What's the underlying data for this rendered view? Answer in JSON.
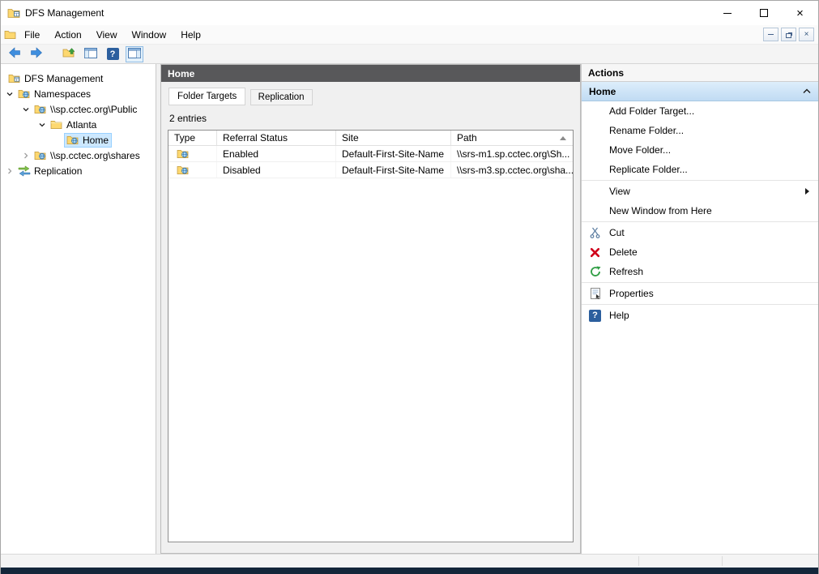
{
  "window": {
    "title": "DFS Management"
  },
  "icons": {
    "close_glyph": "×",
    "help_glyph": "?"
  },
  "menubar": {
    "items": [
      "File",
      "Action",
      "View",
      "Window",
      "Help"
    ]
  },
  "tree": {
    "items": [
      {
        "label": "DFS Management",
        "level": 0,
        "expander": "none",
        "icon": "console-root-icon",
        "selected": false
      },
      {
        "label": "Namespaces",
        "level": 1,
        "expander": "expanded",
        "icon": "namespaces-icon",
        "selected": false
      },
      {
        "label": "\\\\sp.cctec.org\\Public",
        "level": 2,
        "expander": "expanded",
        "icon": "namespace-icon",
        "selected": false
      },
      {
        "label": "Atlanta",
        "level": 3,
        "expander": "expanded",
        "icon": "folder-icon",
        "selected": false
      },
      {
        "label": "Home",
        "level": 4,
        "expander": "none",
        "icon": "folder-target-icon",
        "selected": true
      },
      {
        "label": "\\\\sp.cctec.org\\shares",
        "level": 2,
        "expander": "collapsed",
        "icon": "namespace-icon",
        "selected": false
      },
      {
        "label": "Replication",
        "level": 1,
        "expander": "collapsed",
        "icon": "replication-icon",
        "selected": false
      }
    ]
  },
  "main": {
    "header": "Home",
    "tabs": [
      {
        "label": "Folder Targets",
        "active": true
      },
      {
        "label": "Replication",
        "active": false
      }
    ],
    "entries_label": "2 entries",
    "table": {
      "columns": [
        {
          "label": "Type"
        },
        {
          "label": "Referral Status"
        },
        {
          "label": "Site"
        },
        {
          "label": "Path",
          "sorted": "asc"
        }
      ],
      "rows": [
        {
          "referral_status": "Enabled",
          "site": "Default-First-Site-Name",
          "path": "\\\\srs-m1.sp.cctec.org\\Sh..."
        },
        {
          "referral_status": "Disabled",
          "site": "Default-First-Site-Name",
          "path": "\\\\srs-m3.sp.cctec.org\\sha..."
        }
      ]
    }
  },
  "actions": {
    "title": "Actions",
    "section": {
      "label": "Home"
    },
    "items": [
      {
        "label": "Add Folder Target..."
      },
      {
        "label": "Rename Folder..."
      },
      {
        "label": "Move Folder..."
      },
      {
        "label": "Replicate Folder..."
      },
      {
        "label": "View",
        "submenu": true
      },
      {
        "label": "New Window from Here"
      },
      {
        "label": "Cut",
        "icon": "cut-icon"
      },
      {
        "label": "Delete",
        "icon": "delete-icon"
      },
      {
        "label": "Refresh",
        "icon": "refresh-icon"
      },
      {
        "label": "Properties",
        "icon": "properties-icon"
      },
      {
        "label": "Help",
        "icon": "help-icon"
      }
    ]
  }
}
